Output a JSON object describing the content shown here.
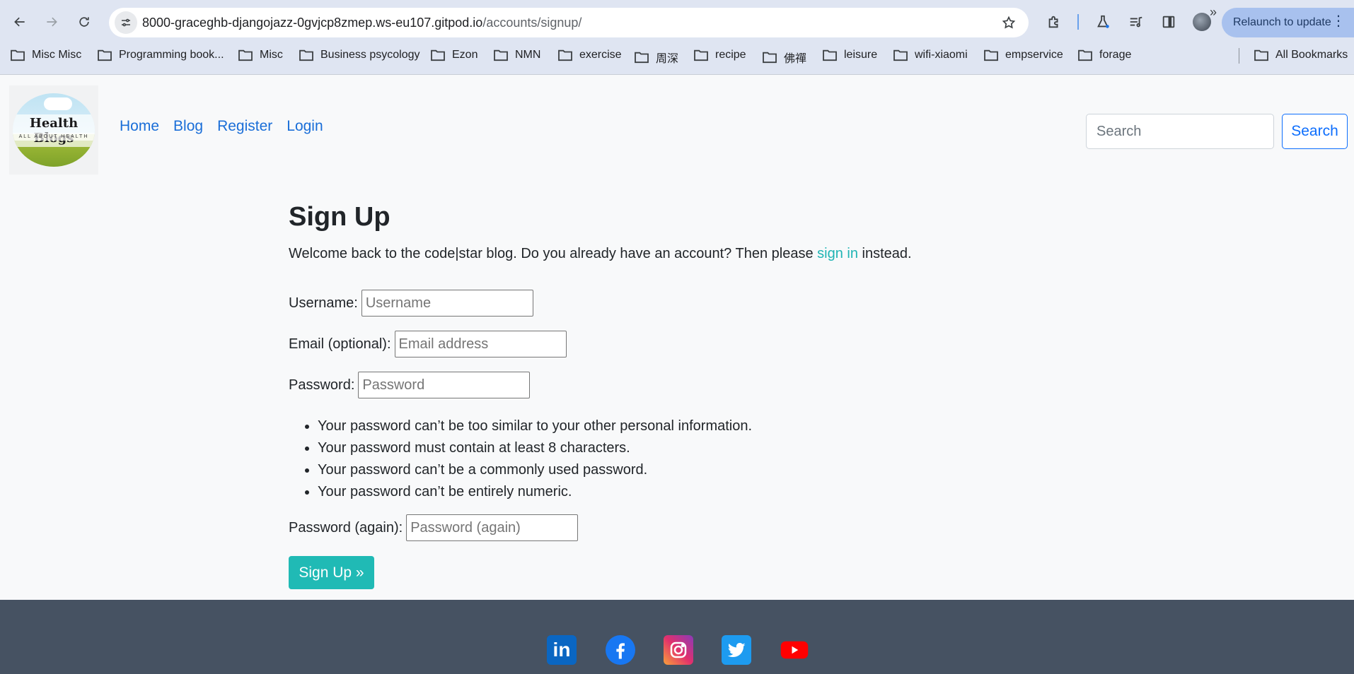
{
  "browser": {
    "url_host": "8000-graceghb-djangojazz-0gvjcp8zmep.ws-eu107.gitpod.io",
    "url_path": "/accounts/signup/",
    "relaunch_label": "Relaunch to update",
    "bookmarks": [
      "Misc Misc",
      "Programming book...",
      "Misc",
      "Business psycology",
      "Ezon",
      "NMN",
      "exercise",
      "周深",
      "recipe",
      "佛禪",
      "leisure",
      "wifi-xiaomi",
      "empservice",
      "forage"
    ],
    "all_bookmarks_label": "All Bookmarks"
  },
  "site": {
    "logo_title": "Health Blogs",
    "logo_subtitle": "ALL ABOUT HEALTH",
    "nav": [
      "Home",
      "Blog",
      "Register",
      "Login"
    ],
    "search_placeholder": "Search",
    "search_button": "Search"
  },
  "signup": {
    "title": "Sign Up",
    "intro_before": "Welcome back to the code|star blog. Do you already have an account? Then please ",
    "intro_link": "sign in",
    "intro_after": " instead.",
    "username_label": "Username:",
    "username_placeholder": "Username",
    "email_label": "Email (optional):",
    "email_placeholder": "Email address",
    "password_label": "Password:",
    "password_placeholder": "Password",
    "password_help": [
      "Your password can’t be too similar to your other personal information.",
      "Your password must contain at least 8 characters.",
      "Your password can’t be a commonly used password.",
      "Your password can’t be entirely numeric."
    ],
    "password2_label": "Password (again):",
    "password2_placeholder": "Password (again)",
    "submit_label": "Sign Up »"
  },
  "footer": {
    "social_icons": [
      "linkedin-icon",
      "facebook-icon",
      "instagram-icon",
      "twitter-icon",
      "youtube-icon"
    ],
    "linkedin_text": "in"
  }
}
